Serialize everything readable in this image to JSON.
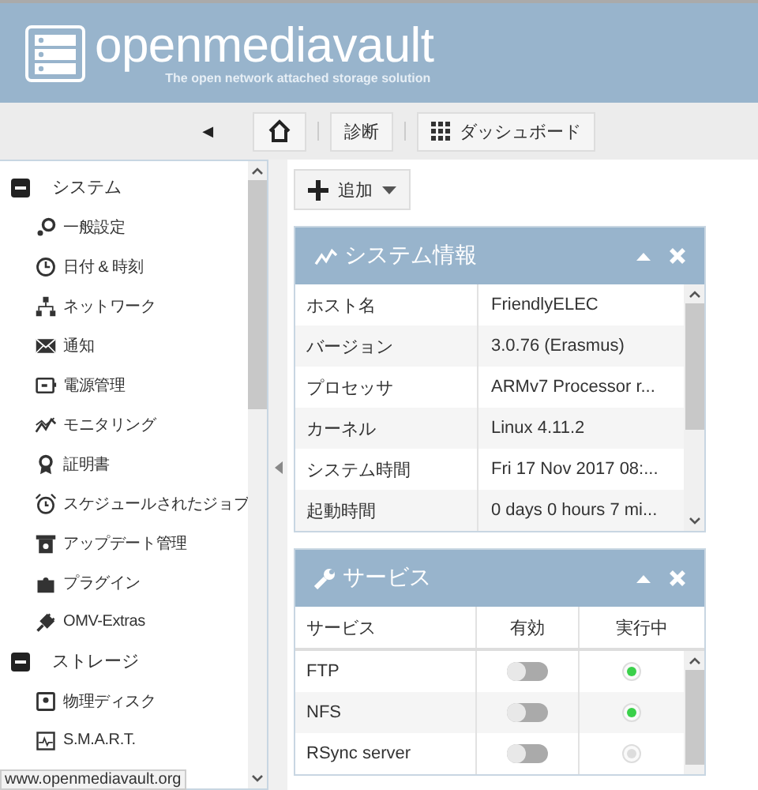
{
  "header": {
    "logo_text": "openmediavault",
    "tagline": "The open network attached storage solution"
  },
  "toolbar": {
    "collapse_glyph": "◀",
    "buttons": [
      {
        "kind": "home"
      },
      {
        "kind": "text",
        "label": "診断"
      },
      {
        "kind": "grid",
        "label": "ダッシュボード"
      }
    ]
  },
  "sidebar": {
    "items": [
      {
        "label": "システム",
        "expanded": true,
        "children": [
          {
            "label": "一般設定"
          },
          {
            "label": "日付 & 時刻"
          },
          {
            "label": "ネットワーク"
          },
          {
            "label": "通知"
          },
          {
            "label": "電源管理"
          },
          {
            "label": "モニタリング"
          },
          {
            "label": "証明書"
          },
          {
            "label": "スケジュールされたジョブ"
          },
          {
            "label": "アップデート管理"
          },
          {
            "label": "プラグイン"
          },
          {
            "label": "OMV-Extras"
          }
        ]
      },
      {
        "label": "ストレージ",
        "expanded": true,
        "children": [
          {
            "label": "物理ディスク"
          },
          {
            "label": "S.M.A.R.T."
          }
        ]
      }
    ]
  },
  "add_button": {
    "label": "追加"
  },
  "system_info": {
    "title": "システム情報",
    "rows": [
      {
        "key": "ホスト名",
        "value": "FriendlyELEC"
      },
      {
        "key": "バージョン",
        "value": "3.0.76 (Erasmus)"
      },
      {
        "key": "プロセッサ",
        "value": "ARMv7 Processor r..."
      },
      {
        "key": "カーネル",
        "value": "Linux 4.11.2"
      },
      {
        "key": "システム時間",
        "value": "Fri 17 Nov 2017 08:..."
      },
      {
        "key": "起動時間",
        "value": "0 days 0 hours 7 mi..."
      }
    ]
  },
  "services": {
    "title": "サービス",
    "columns": [
      "サービス",
      "有効",
      "実行中"
    ],
    "rows": [
      {
        "name": "FTP",
        "enabled": false,
        "running": true
      },
      {
        "name": "NFS",
        "enabled": false,
        "running": true
      },
      {
        "name": "RSync server",
        "enabled": false,
        "running": false
      }
    ]
  },
  "status_url": "www.openmediavault.org"
}
